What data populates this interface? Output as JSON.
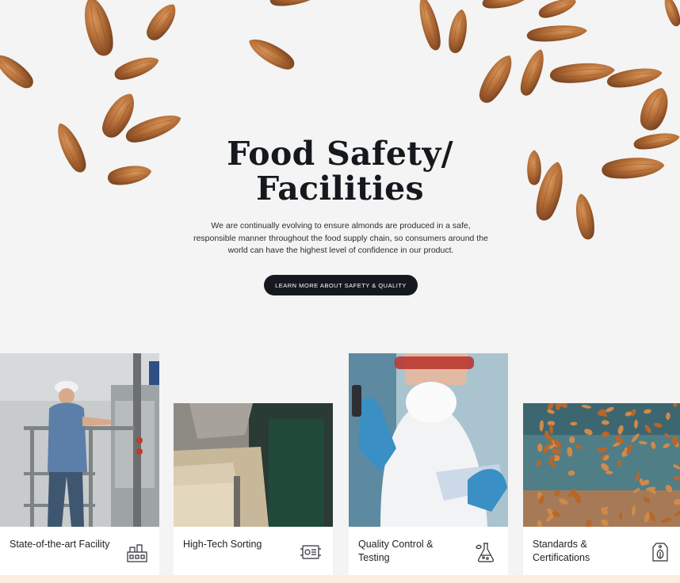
{
  "hero": {
    "title_line1": "Food Safety/",
    "title_line2": "Facilities",
    "description": "We are continually evolving to ensure almonds are produced in a safe, responsible manner throughout the food supply chain, so consumers around the world can have the highest level of confidence in our product.",
    "cta_label": "LEARN MORE ABOUT  SAFETY & QUALITY"
  },
  "cards": [
    {
      "label": "State-of-the-art Facility",
      "icon": "factory-icon"
    },
    {
      "label": "High-Tech Sorting",
      "icon": "sorting-machine-icon"
    },
    {
      "label": "Quality Control & Testing",
      "icon": "lab-flask-icon"
    },
    {
      "label": "Standards & Certifications",
      "icon": "certified-tag-icon"
    }
  ],
  "colors": {
    "background": "#f3f4f3",
    "cta_background": "#15191f",
    "almond": "#b06a35",
    "bottom_strip": "#fcefe2"
  }
}
